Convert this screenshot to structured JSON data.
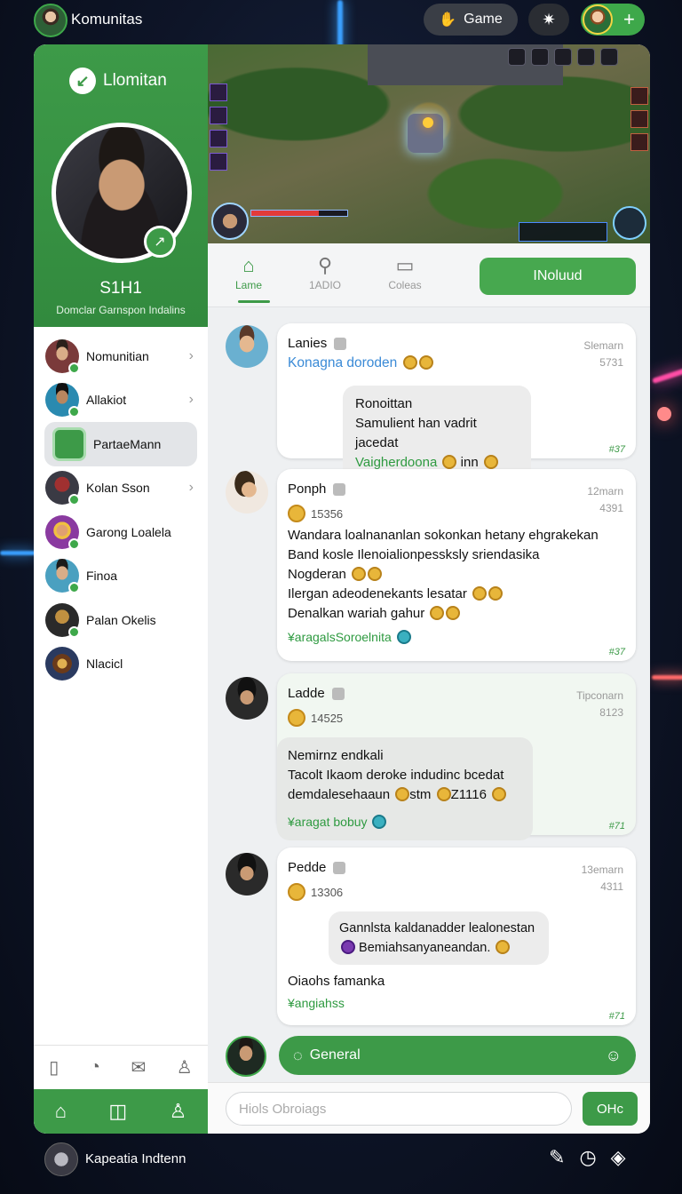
{
  "topbar": {
    "title": "Komunitas",
    "game_button": "Game",
    "game_icon": "thumb-icon",
    "settings_icon": "puzzle-gear-icon",
    "plus_label": "+"
  },
  "sidebar": {
    "brand": "Llomitan",
    "profile_name": "S1H1",
    "profile_subtitle": "Domclar Garnspon Indalins",
    "items": [
      {
        "label": "Nomunitian",
        "chevron": "›"
      },
      {
        "label": "Allakiot",
        "chevron": "›"
      },
      {
        "label": "PartaeMann",
        "chevron": ""
      },
      {
        "label": "Kolan Sson",
        "chevron": "›"
      },
      {
        "label": "Garong Loalela",
        "chevron": ""
      },
      {
        "label": "Finoa",
        "chevron": ""
      },
      {
        "label": "Palan Okelis",
        "chevron": ""
      },
      {
        "label": "Nlacicl",
        "chevron": ""
      }
    ],
    "footer_icons": [
      "clipboard-icon",
      "gamepad-icon",
      "mail-icon",
      "user-icon"
    ],
    "nav_icons": [
      "home-icon",
      "book-icon",
      "profile-icon"
    ]
  },
  "tabs": [
    {
      "label": "Lame",
      "icon": "home-icon"
    },
    {
      "label": "1ADIO",
      "icon": "chat-search-icon"
    },
    {
      "label": "Coleas",
      "icon": "message-icon"
    }
  ],
  "tab_action": "INoluud",
  "posts": [
    {
      "user": "Lanies",
      "meta1": "Slemarn",
      "meta2": "5731",
      "line1": "Konagna doroden",
      "quote_title": "Ronoittan",
      "quote_line": "Samulient han vadrit jacedat",
      "quote_link": "Vaigherdoona",
      "quote_suffix": "inn",
      "count": "#37"
    },
    {
      "user": "Ponph",
      "meta1": "12marn",
      "meta2": "4391",
      "sub": "15356",
      "lines": [
        "Wandara loalnananlan sokonkan hetany ehgrakekan",
        "Band kosle Ilenoialionpessksly sriendasika",
        "Nogderan",
        "Ilergan adeodenekants lesatar",
        "Denalkan wariah gahur"
      ],
      "link": "¥aragalsSoroelnita",
      "count": "#37"
    },
    {
      "user": "Ladde",
      "meta1": "Tipconarn",
      "meta2": "8123",
      "sub": "14525",
      "quote_title": "Nemirnz endkali",
      "quote_line1": "Tacolt Ikaom deroke indudinc bcedat",
      "quote_line2": "demdalesehaaun",
      "quote_tail": "stm",
      "quote_num": "Z1116",
      "link": "¥aragat bobuy",
      "count": "#71"
    },
    {
      "user": "Pedde",
      "meta1": "13emarn",
      "meta2": "4311",
      "sub": "13306",
      "quote_line1": "Gannlsta kaldanadder lealonestan",
      "quote_line2": "Bemiahsanyaneandan.",
      "line": "Oiaohs famanka",
      "link": "¥angiahss",
      "count": "#71"
    }
  ],
  "composer": {
    "channel": "General",
    "placeholder": "Hiols Obroiags",
    "send": "OHc"
  },
  "bottombar": {
    "label": "Kapeatia Indtenn",
    "icons": [
      "pen-icon",
      "clock-icon",
      "chart-icon"
    ]
  },
  "colors": {
    "accent": "#3d9a48",
    "background": "#0e1528"
  }
}
